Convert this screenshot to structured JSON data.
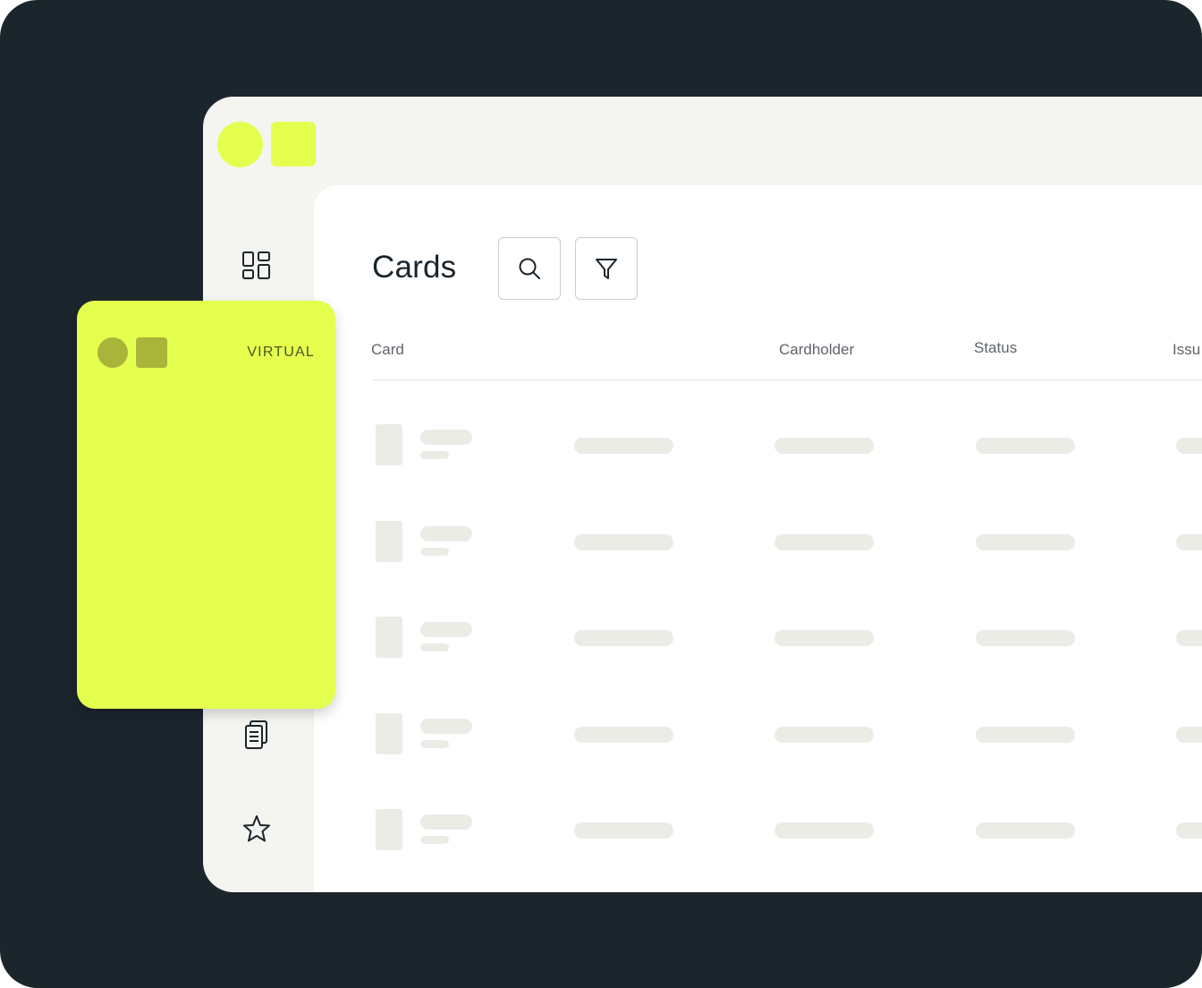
{
  "page": {
    "title": "Cards"
  },
  "toolbar": {
    "search_icon": "search-icon",
    "filter_icon": "filter-icon"
  },
  "table": {
    "columns": [
      "Card",
      "Cardholder",
      "Status",
      "Issu"
    ],
    "skeleton_rows": 5
  },
  "sidebar": {
    "icons": [
      "dashboard-icon",
      "document-icon",
      "star-icon"
    ]
  },
  "virtual_card": {
    "label": "VIRTUAL"
  },
  "colors": {
    "background": "#1b252c",
    "accent": "#e5ff4e",
    "accent_dark": "#a8b43a",
    "skeleton": "#ecece7",
    "window": "#f4f4f0"
  }
}
